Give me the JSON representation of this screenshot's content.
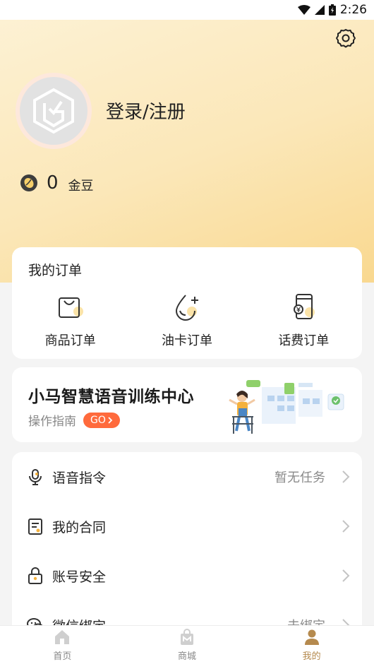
{
  "status_bar": {
    "time": "2:26"
  },
  "profile": {
    "login_text": "登录/注册"
  },
  "coins": {
    "count": "0",
    "label": "金豆"
  },
  "orders": {
    "title": "我的订单",
    "items": [
      {
        "label": "商品订单",
        "icon": "shopping-bag-icon"
      },
      {
        "label": "油卡订单",
        "icon": "oil-drop-icon"
      },
      {
        "label": "话费订单",
        "icon": "phone-bill-icon"
      }
    ]
  },
  "banner": {
    "title": "小马智慧语音训练中心",
    "subtitle": "操作指南",
    "go_label": "GO"
  },
  "menu": {
    "items": [
      {
        "label": "语音指令",
        "value": "暂无任务",
        "icon": "microphone-icon"
      },
      {
        "label": "我的合同",
        "value": "",
        "icon": "contract-icon"
      },
      {
        "label": "账号安全",
        "value": "",
        "icon": "lock-icon"
      },
      {
        "label": "微信绑定",
        "value": "未绑定",
        "icon": "wechat-icon"
      }
    ]
  },
  "bottom_nav": {
    "items": [
      {
        "label": "首页",
        "icon": "home-icon",
        "active": false
      },
      {
        "label": "商城",
        "icon": "mall-icon",
        "active": false
      },
      {
        "label": "我的",
        "icon": "profile-icon",
        "active": true
      }
    ]
  },
  "colors": {
    "accent": "#b58a4e",
    "go_badge": "#ff6a3c",
    "hero_start": "#fdf2d6",
    "hero_end": "#f9d88f"
  }
}
